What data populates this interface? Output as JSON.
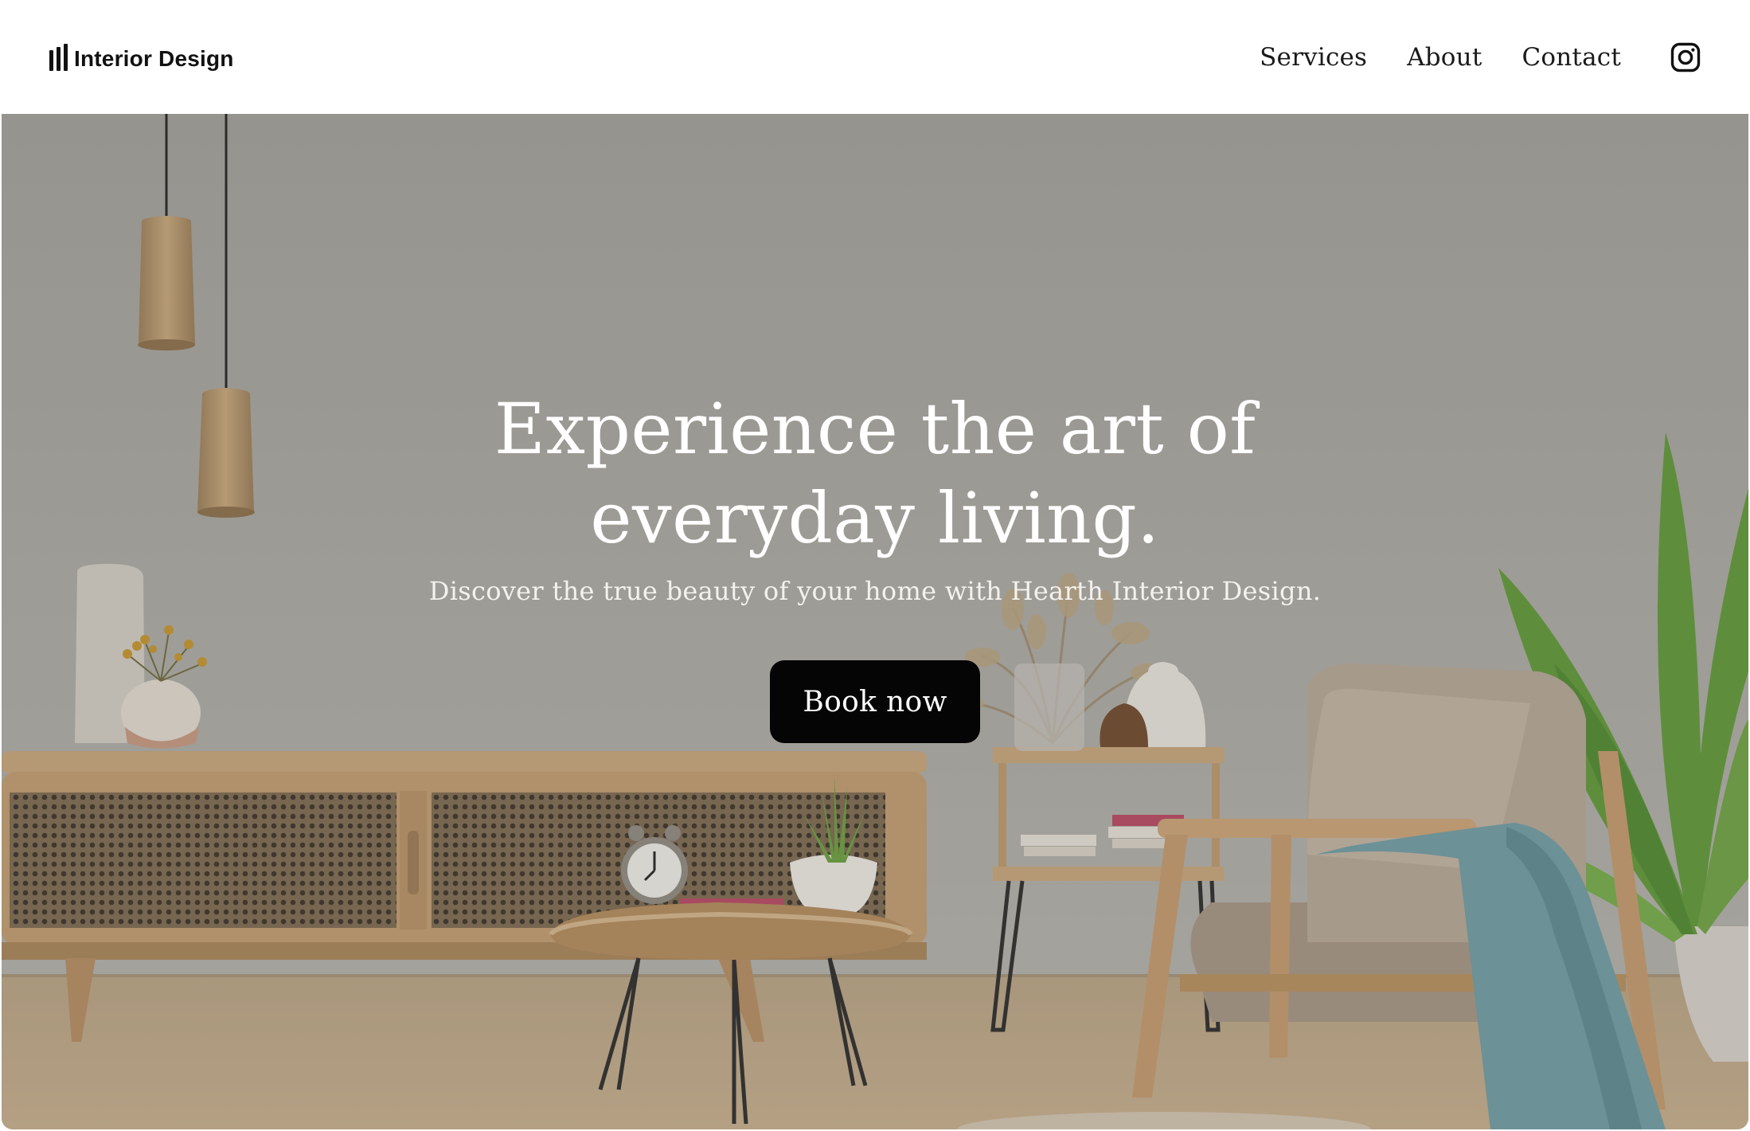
{
  "brand": {
    "name": "Interior Design"
  },
  "nav": {
    "items": [
      "Services",
      "About",
      "Contact"
    ],
    "social_icon": "instagram-icon"
  },
  "hero": {
    "title_line1": "Experience the art of",
    "title_line2": "everyday living.",
    "subtitle": "Discover the true beauty of your home with Hearth Interior Design.",
    "cta_label": "Book now"
  },
  "colors": {
    "text_dark": "#111111",
    "button_bg": "#050505",
    "hero_overlay": "#a9a8a1",
    "wood": "#c9a57a",
    "plant": "#5f9a3a",
    "throw": "#6d9ea6"
  }
}
